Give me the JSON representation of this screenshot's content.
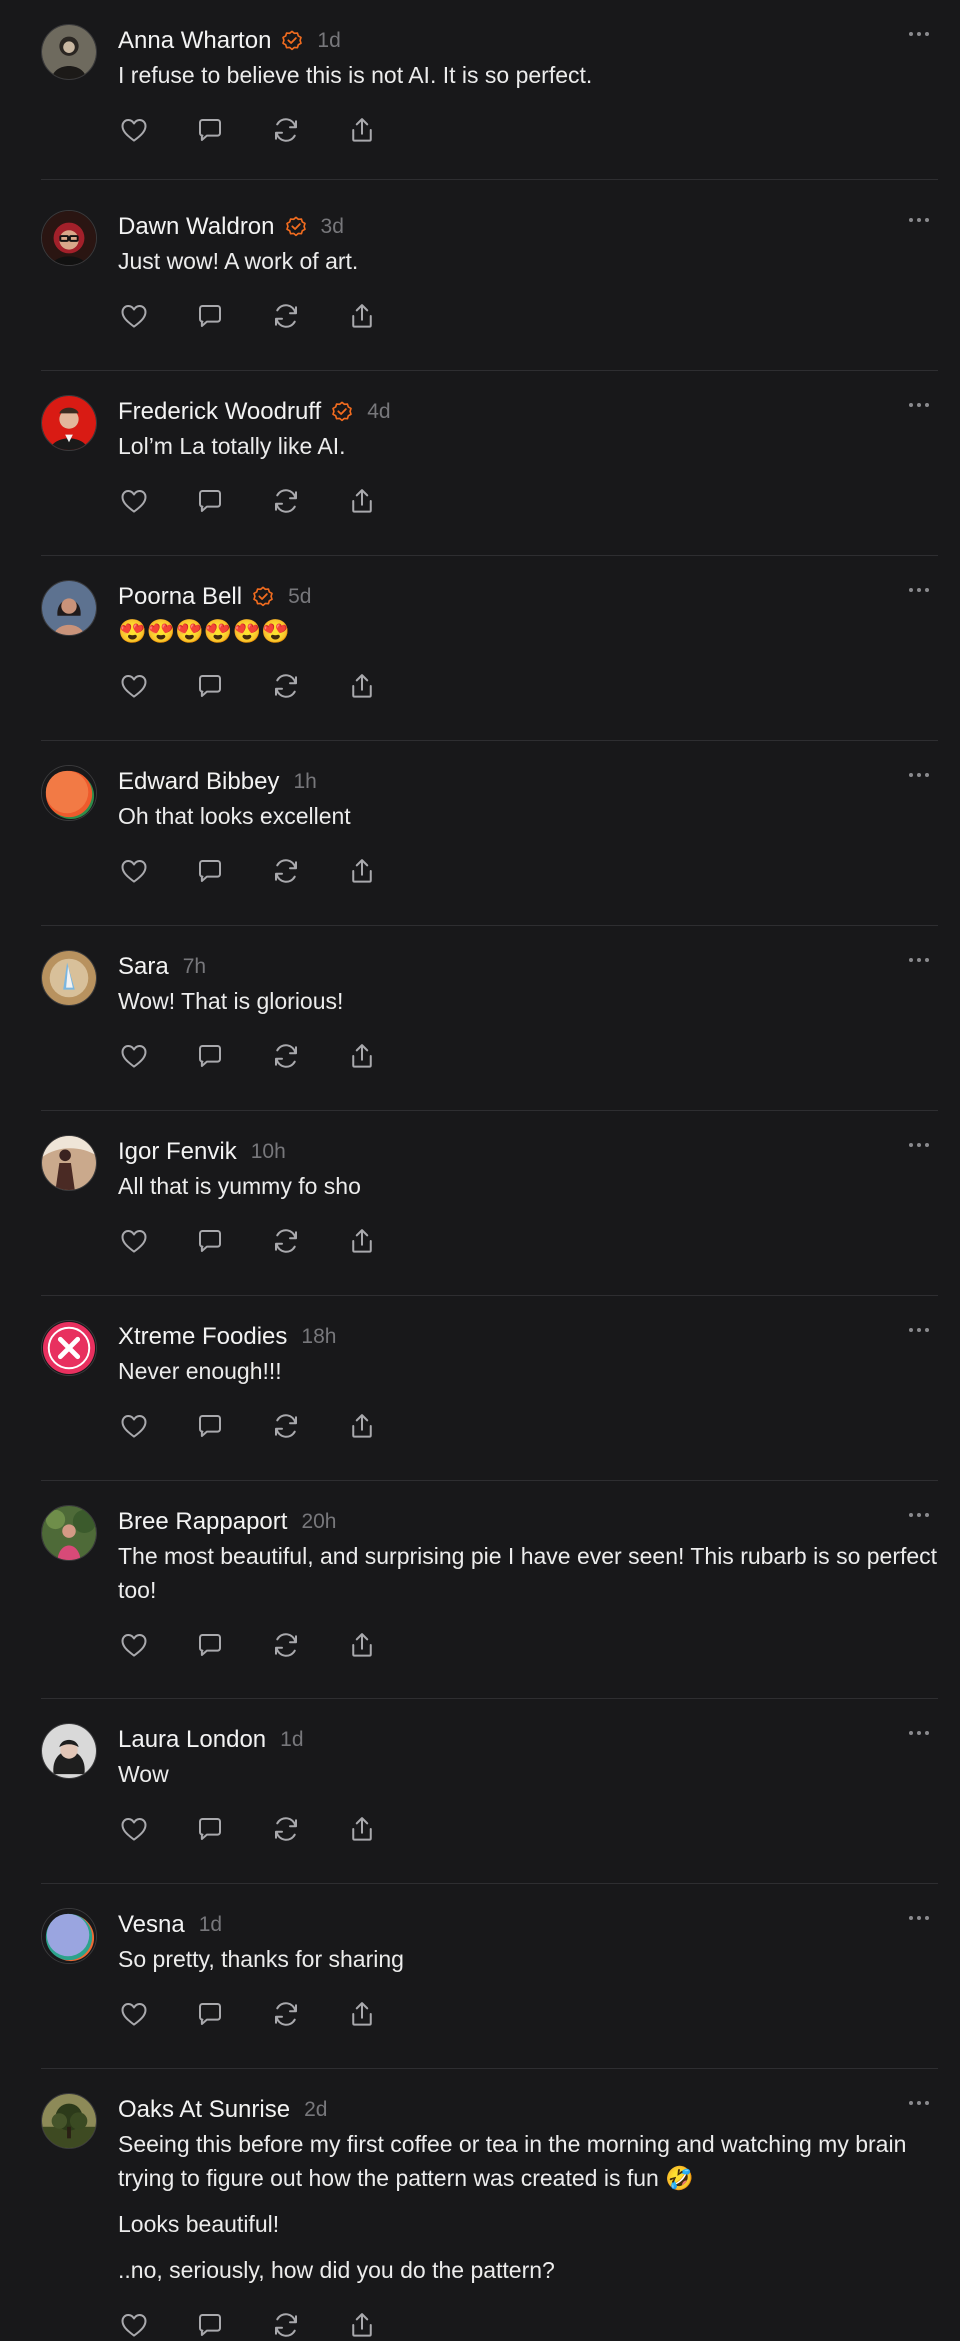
{
  "comments": [
    {
      "author": "Anna Wharton",
      "verified": true,
      "time": "1d",
      "text": [
        "I refuse to believe this is not AI. It is so perfect."
      ],
      "avatar": "avatar-anna"
    },
    {
      "author": "Dawn Waldron",
      "verified": true,
      "time": "3d",
      "text": [
        "Just wow! A work of art."
      ],
      "avatar": "avatar-dawn"
    },
    {
      "author": "Frederick Woodruff",
      "verified": true,
      "time": "4d",
      "text": [
        "Lol’m La totally like AI."
      ],
      "avatar": "avatar-frederick"
    },
    {
      "author": "Poorna Bell",
      "verified": true,
      "time": "5d",
      "text": [
        "😍😍😍😍😍😍"
      ],
      "avatar": "avatar-poorna"
    },
    {
      "author": "Edward Bibbey",
      "verified": false,
      "time": "1h",
      "text": [
        "Oh that looks excellent"
      ],
      "avatar": "avatar-edward"
    },
    {
      "author": "Sara",
      "verified": false,
      "time": "7h",
      "text": [
        "Wow! That is glorious!"
      ],
      "avatar": "avatar-sara"
    },
    {
      "author": "Igor Fenvik",
      "verified": false,
      "time": "10h",
      "text": [
        "All that is yummy fo sho"
      ],
      "avatar": "avatar-igor"
    },
    {
      "author": "Xtreme Foodies",
      "verified": false,
      "time": "18h",
      "text": [
        "Never enough!!!"
      ],
      "avatar": "avatar-xtreme"
    },
    {
      "author": "Bree Rappaport",
      "verified": false,
      "time": "20h",
      "text": [
        "The most beautiful, and surprising pie I have ever seen! This rubarb is so perfect too!"
      ],
      "avatar": "avatar-bree"
    },
    {
      "author": "Laura London",
      "verified": false,
      "time": "1d",
      "text": [
        "Wow"
      ],
      "avatar": "avatar-laura"
    },
    {
      "author": "Vesna",
      "verified": false,
      "time": "1d",
      "text": [
        "So pretty, thanks for sharing"
      ],
      "avatar": "avatar-vesna"
    },
    {
      "author": "Oaks At Sunrise",
      "verified": false,
      "time": "2d",
      "text": [
        "Seeing this before my first coffee or tea in the morning and watching my brain trying to figure out how the pattern was created is fun 🤣",
        "Looks beautiful!",
        "..no, seriously, how did you do the pattern?"
      ],
      "avatar": "avatar-oaks"
    }
  ],
  "icons": {
    "verified": "verified-badge-icon",
    "like": "heart-icon",
    "reply": "speech-bubble-icon",
    "repost": "repost-icon",
    "share": "share-icon",
    "more": "more-dots-icon"
  },
  "colors": {
    "background": "#18181a",
    "divider": "#2e2e31",
    "verified_badge": "#f26c1f",
    "muted_text": "#77777b"
  }
}
